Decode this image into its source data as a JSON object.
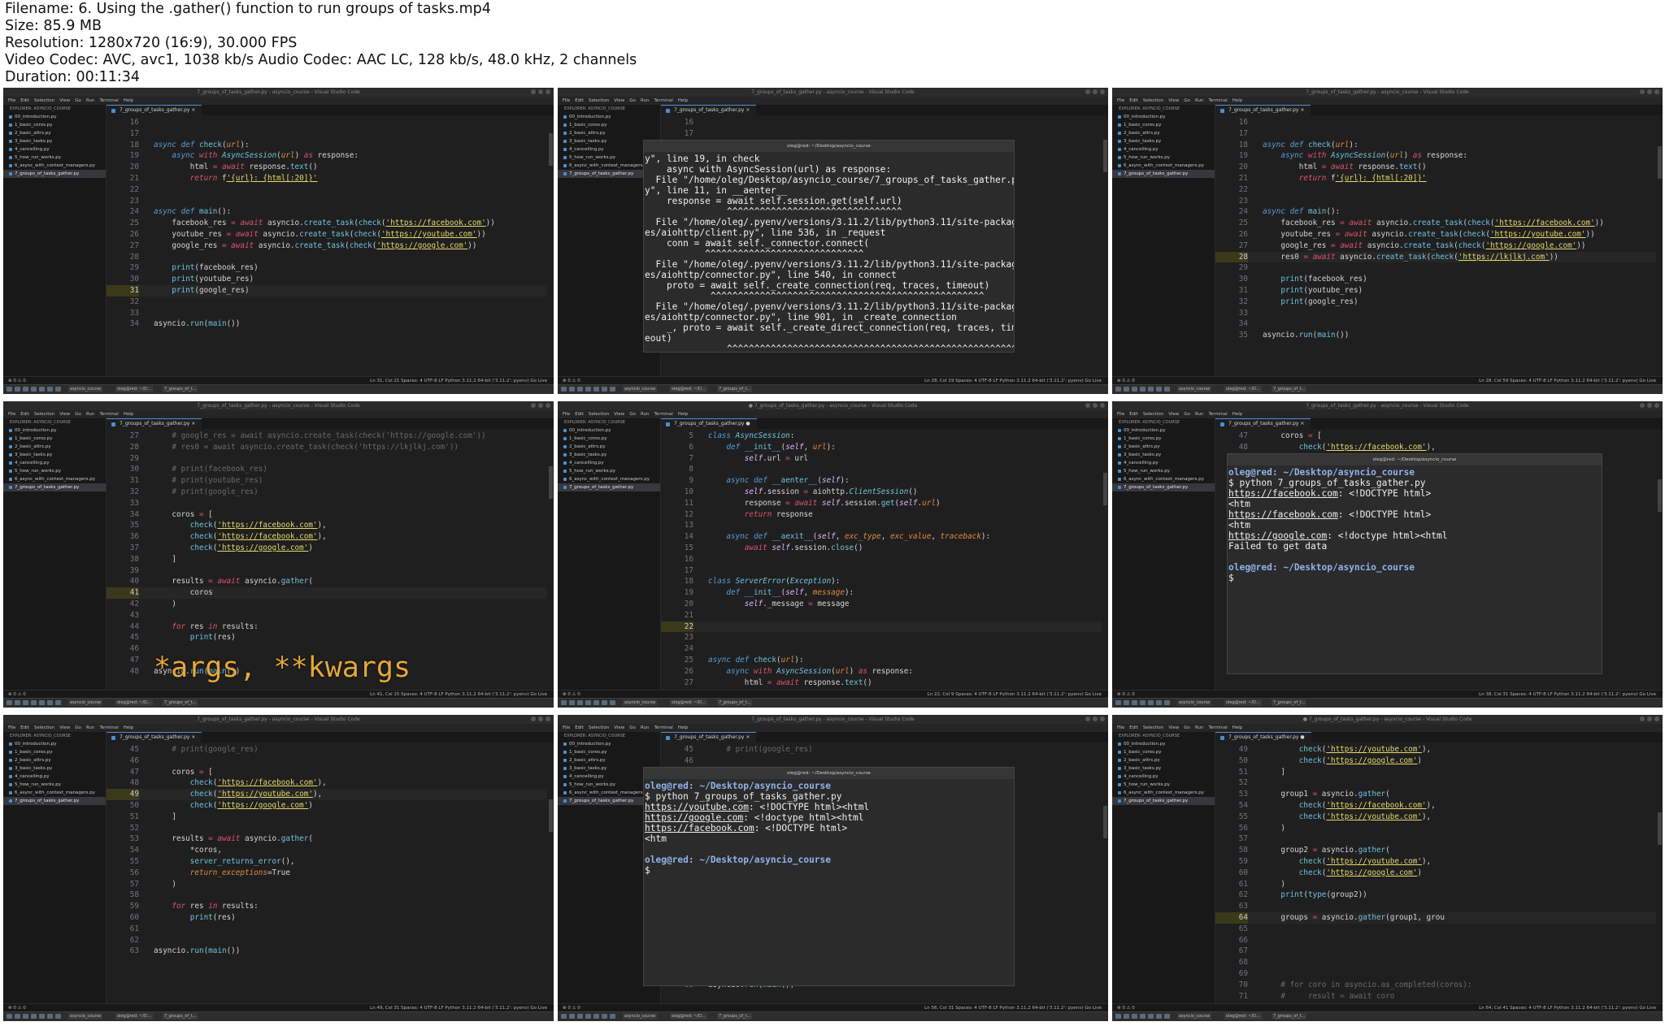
{
  "header": {
    "filename": "Filename: 6. Using the .gather() function to run groups of tasks.mp4",
    "size": "Size: 85.9 MB",
    "resolution": "Resolution: 1280x720 (16:9), 30.000 FPS",
    "codec": "Video Codec: AVC, avc1, 1038 kb/s Audio Codec: AAC LC, 128 kb/s, 48.0 kHz, 2 channels",
    "duration": "Duration: 00:11:34"
  },
  "common": {
    "window_title": "7_groups_of_tasks_gather.py - asyncio_course - Visual Studio Code",
    "window_title_dirty": "● 7_groups_of_tasks_gather.py - asyncio_course - Visual Studio Code",
    "terminal_title": "oleg@red: ~/Desktop/asyncio_course",
    "menu": [
      "File",
      "Edit",
      "Selection",
      "View",
      "Go",
      "Run",
      "Terminal",
      "Help"
    ],
    "explorer_title": "EXPLORER: ASYNCIO_COURSE",
    "files": [
      "00_introduction.py",
      "1_basic_coros.py",
      "2_basic_attrs.py",
      "3_basic_tasks.py",
      "4_cancelling.py",
      "5_how_run_works.py",
      "6_async_with_context_managers.py",
      "7_groups_of_tasks_gather.py"
    ],
    "active_tab": "7_groups_of_tasks_gather.py",
    "status_left": "⊗ 0 ⚠ 0",
    "taskbar_items": [
      "asyncio_course",
      "oleg@red: ~/D...",
      "7_groups_of_t..."
    ]
  },
  "tiles": [
    {
      "status_right": "Ln 31, Col 21   Spaces: 4   UTF-8   LF   Python   3.11.2 64-bit ('3.11.2': pyenv)   Go Live",
      "lines": [
        {
          "n": "16",
          "t": ""
        },
        {
          "n": "17",
          "t": ""
        },
        {
          "n": "18",
          "t": "async def check(url):"
        },
        {
          "n": "19",
          "t": "    async with AsyncSession(url) as response:"
        },
        {
          "n": "20",
          "t": "        html = await response.text()"
        },
        {
          "n": "21",
          "t": "        return f'{url}: {html[:20]}'"
        },
        {
          "n": "22",
          "t": ""
        },
        {
          "n": "23",
          "t": ""
        },
        {
          "n": "24",
          "t": "async def main():"
        },
        {
          "n": "25",
          "t": "    facebook_res = await asyncio.create_task(check('https://facebook.com'))"
        },
        {
          "n": "26",
          "t": "    youtube_res = await asyncio.create_task(check('https://youtube.com'))"
        },
        {
          "n": "27",
          "t": "    google_res = await asyncio.create_task(check('https://google.com'))"
        },
        {
          "n": "28",
          "t": ""
        },
        {
          "n": "29",
          "t": "    print(facebook_res)"
        },
        {
          "n": "30",
          "t": "    print(youtube_res)"
        },
        {
          "n": "31",
          "t": "    print(google_res)"
        },
        {
          "n": "32",
          "t": ""
        },
        {
          "n": "33",
          "t": ""
        },
        {
          "n": "34",
          "t": "asyncio.run(main())"
        }
      ]
    },
    {
      "status_right": "Ln 28, Col 19   Spaces: 4   UTF-8   LF   Python   3.11.2 64-bit ('3.11.2': pyenv)   Go Live",
      "lines": [
        {
          "n": "16",
          "t": ""
        },
        {
          "n": "17",
          "t": ""
        }
      ],
      "terminal": [
        "y\", line 19, in check",
        "    async with AsyncSession(url) as response:",
        "  File \"/home/oleg/Desktop/asyncio_course/7_groups_of_tasks_gather.p",
        "y\", line 11, in __aenter__",
        "    response = await self.session.get(self.url)",
        "               ^^^^^^^^^^^^^^^^^^^^^^^^^^^^^^^^",
        "  File \"/home/oleg/.pyenv/versions/3.11.2/lib/python3.11/site-packag",
        "es/aiohttp/client.py\", line 536, in _request",
        "    conn = await self._connector.connect(",
        "           ^^^^^^^^^^^^^^^^^^^^^^^^^^^^^",
        "  File \"/home/oleg/.pyenv/versions/3.11.2/lib/python3.11/site-packag",
        "es/aiohttp/connector.py\", line 540, in connect",
        "    proto = await self._create_connection(req, traces, timeout)",
        "            ^^^^^^^^^^^^^^^^^^^^^^^^^^^^^^^^^^^^^^^^^^^^^^^^^^",
        "  File \"/home/oleg/.pyenv/versions/3.11.2/lib/python3.11/site-packag",
        "es/aiohttp/connector.py\", line 901, in _create_connection",
        "    _, proto = await self._create_direct_connection(req, traces, tim",
        "eout)",
        "               ^^^^^^^^^^^^^^^^^^^^^^^^^^^^^^^^^^^^^^^^^^^^^^^^^^^^^",
        "^^^^"
      ]
    },
    {
      "status_right": "Ln 28, Col 59   Spaces: 4   UTF-8   LF   Python   3.11.2 64-bit ('3.11.2': pyenv)   Go Live",
      "lines": [
        {
          "n": "16",
          "t": ""
        },
        {
          "n": "17",
          "t": ""
        },
        {
          "n": "18",
          "t": "async def check(url):"
        },
        {
          "n": "19",
          "t": "    async with AsyncSession(url) as response:"
        },
        {
          "n": "20",
          "t": "        html = await response.text()"
        },
        {
          "n": "21",
          "t": "        return f'{url}: {html[:20]}'"
        },
        {
          "n": "22",
          "t": ""
        },
        {
          "n": "23",
          "t": ""
        },
        {
          "n": "24",
          "t": "async def main():"
        },
        {
          "n": "25",
          "t": "    facebook_res = await asyncio.create_task(check('https://facebook.com'))"
        },
        {
          "n": "26",
          "t": "    youtube_res = await asyncio.create_task(check('https://youtube.com'))"
        },
        {
          "n": "27",
          "t": "    google_res = await asyncio.create_task(check('https://google.com'))"
        },
        {
          "n": "28",
          "t": "    res0 = await asyncio.create_task(check('https://lkjlkj.com'))"
        },
        {
          "n": "29",
          "t": ""
        },
        {
          "n": "30",
          "t": "    print(facebook_res)"
        },
        {
          "n": "31",
          "t": "    print(youtube_res)"
        },
        {
          "n": "32",
          "t": "    print(google_res)"
        },
        {
          "n": "33",
          "t": ""
        },
        {
          "n": "34",
          "t": ""
        },
        {
          "n": "35",
          "t": "asyncio.run(main())"
        }
      ]
    },
    {
      "status_right": "Ln 41, Col 15   Spaces: 4   UTF-8   LF   Python   3.11.2 64-bit ('3.11.2': pyenv)   Go Live",
      "overlay": "*args, **kwargs",
      "lines": [
        {
          "n": "27",
          "t": "    # google_res = await asyncio.create_task(check('https://google.com'))"
        },
        {
          "n": "28",
          "t": "    # res0 = await asyncio.create_task(check('https://lkjlkj.com'))"
        },
        {
          "n": "29",
          "t": ""
        },
        {
          "n": "30",
          "t": "    # print(facebook_res)"
        },
        {
          "n": "31",
          "t": "    # print(youtube_res)"
        },
        {
          "n": "32",
          "t": "    # print(google_res)"
        },
        {
          "n": "33",
          "t": ""
        },
        {
          "n": "34",
          "t": "    coros = ["
        },
        {
          "n": "35",
          "t": "        check('https://facebook.com'),"
        },
        {
          "n": "36",
          "t": "        check('https://facebook.com'),"
        },
        {
          "n": "37",
          "t": "        check('https://google.com')"
        },
        {
          "n": "38",
          "t": "    ]"
        },
        {
          "n": "39",
          "t": ""
        },
        {
          "n": "40",
          "t": "    results = await asyncio.gather("
        },
        {
          "n": "41",
          "t": "        coros"
        },
        {
          "n": "42",
          "t": "    )"
        },
        {
          "n": "43",
          "t": ""
        },
        {
          "n": "44",
          "t": "    for res in results:"
        },
        {
          "n": "45",
          "t": "        print(res)"
        },
        {
          "n": "46",
          "t": ""
        },
        {
          "n": "47",
          "t": ""
        },
        {
          "n": "48",
          "t": "asyncio.run(main())"
        }
      ]
    },
    {
      "status_right": "Ln 22, Col 9   Spaces: 4   UTF-8   LF   Python   3.11.2 64-bit ('3.11.2': pyenv)   Go Live",
      "lines": [
        {
          "n": "5",
          "t": "class AsyncSession:"
        },
        {
          "n": "6",
          "t": "    def __init__(self, url):"
        },
        {
          "n": "7",
          "t": "        self.url = url"
        },
        {
          "n": "8",
          "t": ""
        },
        {
          "n": "9",
          "t": "    async def __aenter__(self):"
        },
        {
          "n": "10",
          "t": "        self.session = aiohttp.ClientSession()"
        },
        {
          "n": "11",
          "t": "        response = await self.session.get(self.url)"
        },
        {
          "n": "12",
          "t": "        return response"
        },
        {
          "n": "13",
          "t": ""
        },
        {
          "n": "14",
          "t": "    async def __aexit__(self, exc_type, exc_value, traceback):"
        },
        {
          "n": "15",
          "t": "        await self.session.close()"
        },
        {
          "n": "16",
          "t": ""
        },
        {
          "n": "17",
          "t": ""
        },
        {
          "n": "18",
          "t": "class ServerError(Exception):"
        },
        {
          "n": "19",
          "t": "    def __init__(self, message):"
        },
        {
          "n": "20",
          "t": "        self._message = message"
        },
        {
          "n": "21",
          "t": ""
        },
        {
          "n": "22",
          "t": ""
        },
        {
          "n": "23",
          "t": ""
        },
        {
          "n": "24",
          "t": ""
        },
        {
          "n": "25",
          "t": "async def check(url):"
        },
        {
          "n": "26",
          "t": "    async with AsyncSession(url) as response:"
        },
        {
          "n": "27",
          "t": "        html = await response.text()"
        }
      ]
    },
    {
      "status_right": "Ln 38, Col 31   Spaces: 4   UTF-8   LF   Python   3.11.2 64-bit ('3.11.2': pyenv)   Go Live",
      "lines": [
        {
          "n": "47",
          "t": "    coros = ["
        },
        {
          "n": "48",
          "t": "        check('https://facebook.com'),"
        }
      ],
      "terminal": [
        "oleg@red: ~/Desktop/asyncio_course",
        "$ python 7_groups_of_tasks_gather.py",
        "https://facebook.com: <!DOCTYPE html>",
        "<htm",
        "https://facebook.com: <!DOCTYPE html>",
        "<htm",
        "https://google.com: <!doctype html><html",
        "Failed to get data",
        "",
        "oleg@red: ~/Desktop/asyncio_course",
        "$"
      ]
    },
    {
      "status_right": "Ln 49, Col 31   Spaces: 4   UTF-8   LF   Python   3.11.2 64-bit ('3.11.2': pyenv)   Go Live",
      "lines": [
        {
          "n": "45",
          "t": "    # print(google_res)"
        },
        {
          "n": "46",
          "t": ""
        },
        {
          "n": "47",
          "t": "    coros = ["
        },
        {
          "n": "48",
          "t": "        check('https://facebook.com'),"
        },
        {
          "n": "49",
          "t": "        check('https://youtube.com'),"
        },
        {
          "n": "50",
          "t": "        check('https://google.com')"
        },
        {
          "n": "51",
          "t": "    ]"
        },
        {
          "n": "52",
          "t": ""
        },
        {
          "n": "53",
          "t": "    results = await asyncio.gather("
        },
        {
          "n": "54",
          "t": "        *coros,"
        },
        {
          "n": "55",
          "t": "        server_returns_error(),"
        },
        {
          "n": "56",
          "t": "        return_exceptions=True"
        },
        {
          "n": "57",
          "t": "    )"
        },
        {
          "n": "58",
          "t": ""
        },
        {
          "n": "59",
          "t": "    for res in results:"
        },
        {
          "n": "60",
          "t": "        print(res)"
        },
        {
          "n": "61",
          "t": ""
        },
        {
          "n": "62",
          "t": ""
        },
        {
          "n": "63",
          "t": "asyncio.run(main())"
        }
      ]
    },
    {
      "status_right": "Ln 56, Col 31   Spaces: 4   UTF-8   LF   Python   3.11.2 64-bit ('3.11.2': pyenv)   Go Live",
      "lines": [
        {
          "n": "45",
          "t": "    # print(google_res)"
        },
        {
          "n": "46",
          "t": ""
        }
      ],
      "bottom_lines": [
        {
          "n": "67",
          "t": ""
        },
        {
          "n": "68",
          "t": "asyncio.run(main())"
        }
      ],
      "terminal": [
        "oleg@red: ~/Desktop/asyncio_course",
        "$ python 7_groups_of_tasks_gather.py",
        "https://youtube.com: <!DOCTYPE html><html",
        "https://google.com: <!doctype html><html",
        "https://facebook.com: <!DOCTYPE html>",
        "<htm",
        "",
        "oleg@red: ~/Desktop/asyncio_course",
        "$"
      ]
    },
    {
      "status_right": "Ln 64, Col 41   Spaces: 4   UTF-8   LF   Python   3.11.2 64-bit ('3.11.2': pyenv)   Go Live",
      "lines": [
        {
          "n": "49",
          "t": "        check('https://youtube.com'),"
        },
        {
          "n": "50",
          "t": "        check('https://google.com')"
        },
        {
          "n": "51",
          "t": "    ]"
        },
        {
          "n": "52",
          "t": ""
        },
        {
          "n": "53",
          "t": "    group1 = asyncio.gather("
        },
        {
          "n": "54",
          "t": "        check('https://facebook.com'),"
        },
        {
          "n": "55",
          "t": "        check('https://youtube.com'),"
        },
        {
          "n": "56",
          "t": "    )"
        },
        {
          "n": "57",
          "t": ""
        },
        {
          "n": "58",
          "t": "    group2 = asyncio.gather("
        },
        {
          "n": "59",
          "t": "        check('https://youtube.com'),"
        },
        {
          "n": "60",
          "t": "        check('https://google.com')"
        },
        {
          "n": "61",
          "t": "    )"
        },
        {
          "n": "62",
          "t": "    print(type(group2))"
        },
        {
          "n": "63",
          "t": ""
        },
        {
          "n": "64",
          "t": "    groups = asyncio.gather(group1, grou"
        },
        {
          "n": "65",
          "t": ""
        },
        {
          "n": "66",
          "t": ""
        },
        {
          "n": "67",
          "t": ""
        },
        {
          "n": "68",
          "t": ""
        },
        {
          "n": "69",
          "t": ""
        },
        {
          "n": "70",
          "t": "    # for coro in asyncio.as_completed(coros):"
        },
        {
          "n": "71",
          "t": "    #     result = await coro"
        }
      ]
    }
  ]
}
